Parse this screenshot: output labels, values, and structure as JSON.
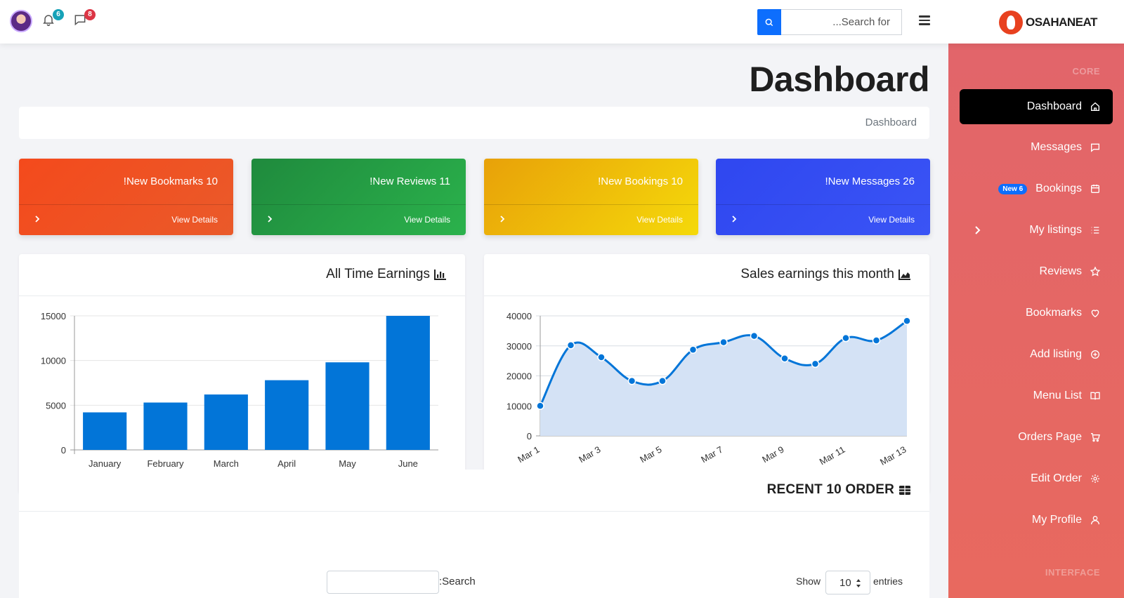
{
  "topbar": {
    "notifications_count": "6",
    "messages_count": "8",
    "search_placeholder": "...Search for",
    "logo_text": "OSAHANEAT",
    "colors": {
      "notif_badge": "#17a2b8",
      "msg_badge": "#dc3545",
      "search_button": "#0d6efd"
    }
  },
  "page": {
    "title": "Dashboard",
    "breadcrumb": "Dashboard"
  },
  "stats": [
    {
      "label": "!New Bookmarks 10",
      "link": "View Details",
      "color_from": "#f44a1c",
      "color_to": "#ea5a2a"
    },
    {
      "label": "!New Reviews 11",
      "link": "View Details",
      "color_from": "#1f8a3d",
      "color_to": "#2bb24c"
    },
    {
      "label": "!New Bookings 10",
      "link": "View Details",
      "color_from": "#e8a109",
      "color_to": "#f5d90a"
    },
    {
      "label": "!New Messages 26",
      "link": "View Details",
      "color_from": "#2f47f0",
      "color_to": "#3a54f5"
    }
  ],
  "earnings_card": {
    "title": "All Time Earnings"
  },
  "sales_card": {
    "title": "Sales earnings this month"
  },
  "orders_card": {
    "title": "RECENT 10 ORDER",
    "search_label": ":Search",
    "show_label": "Show",
    "entries_value": "10",
    "entries_label": "entries"
  },
  "sidebar": {
    "heading_core": "CORE",
    "heading_interface": "INTERFACE",
    "items": [
      {
        "label": "Dashboard",
        "icon": "home-icon",
        "active": true
      },
      {
        "label": "Messages",
        "icon": "message-icon"
      },
      {
        "label": "Bookings",
        "icon": "calendar-icon",
        "badge": "New 6"
      },
      {
        "label": "My listings",
        "icon": "list-icon",
        "caret": true
      },
      {
        "label": "Reviews",
        "icon": "star-icon"
      },
      {
        "label": "Bookmarks",
        "icon": "heart-icon"
      },
      {
        "label": "Add listing",
        "icon": "plus-circle-icon"
      },
      {
        "label": "Menu List",
        "icon": "book-icon"
      },
      {
        "label": "Orders Page",
        "icon": "cart-icon"
      },
      {
        "label": "Edit Order",
        "icon": "gear-icon"
      },
      {
        "label": "My Profile",
        "icon": "user-icon"
      }
    ]
  },
  "chart_data": [
    {
      "type": "bar",
      "title": "All Time Earnings",
      "categories": [
        "January",
        "February",
        "March",
        "April",
        "May",
        "June"
      ],
      "values": [
        4200,
        5300,
        6200,
        7800,
        9800,
        15000
      ],
      "ylim": [
        0,
        15000
      ],
      "yticks": [
        0,
        5000,
        10000,
        15000
      ],
      "color": "#0275d8",
      "grid": true
    },
    {
      "type": "area",
      "title": "Sales earnings this month",
      "x": [
        "Mar 1",
        "Mar 2",
        "Mar 3",
        "Mar 4",
        "Mar 5",
        "Mar 6",
        "Mar 7",
        "Mar 8",
        "Mar 9",
        "Mar 10",
        "Mar 11",
        "Mar 12",
        "Mar 13"
      ],
      "xtick_labels": [
        "Mar 1",
        "Mar 3",
        "Mar 5",
        "Mar 7",
        "Mar 9",
        "Mar 11",
        "Mar 13"
      ],
      "values": [
        10000,
        30200,
        26200,
        18300,
        18300,
        28700,
        31200,
        33300,
        25800,
        24000,
        32600,
        31800,
        38300
      ],
      "ylim": [
        0,
        40000
      ],
      "yticks": [
        0,
        10000,
        20000,
        30000,
        40000
      ],
      "line_color": "#0275d8",
      "fill_color": "#d4e2f5",
      "grid": true
    }
  ]
}
